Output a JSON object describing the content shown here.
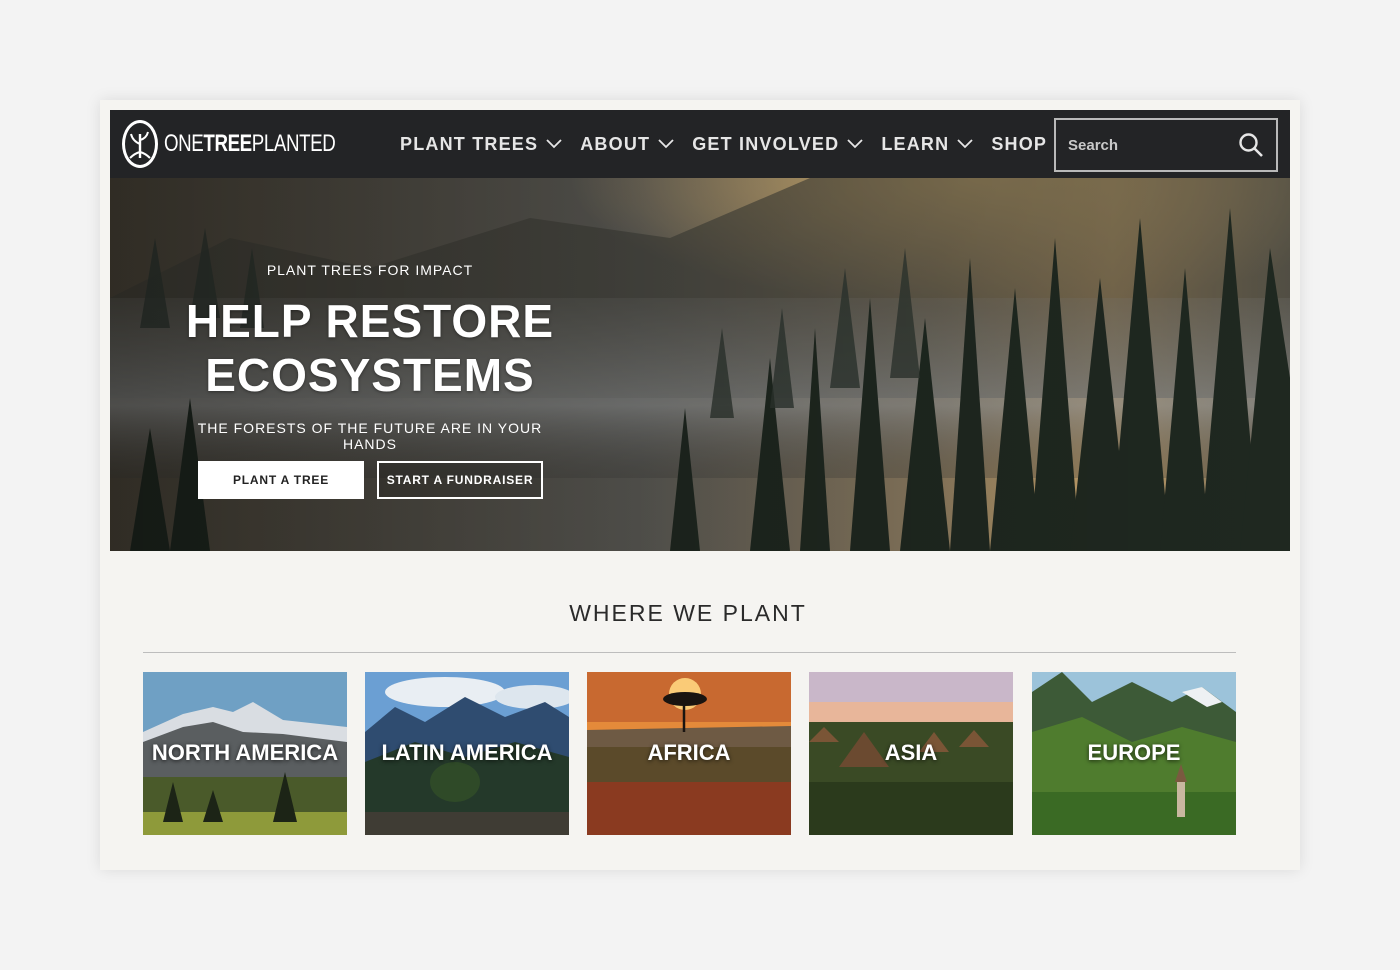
{
  "brand": {
    "name_light": "ONE",
    "name_bold": "TREE",
    "name_end": "PLANTED"
  },
  "nav": {
    "items": [
      {
        "label": "PLANT TREES"
      },
      {
        "label": "ABOUT"
      },
      {
        "label": "GET INVOLVED"
      },
      {
        "label": "LEARN"
      },
      {
        "label": "SHOP"
      }
    ],
    "search_placeholder": "Search"
  },
  "hero": {
    "eyebrow": "PLANT TREES FOR IMPACT",
    "headline_line1": "HELP RESTORE",
    "headline_line2": "ECOSYSTEMS",
    "subline": "THE FORESTS OF THE FUTURE ARE IN YOUR HANDS",
    "primary_button": "PLANT A TREE",
    "secondary_button": "START A FUNDRAISER"
  },
  "regions": {
    "title": "WHERE WE PLANT",
    "items": [
      {
        "label": "NORTH AMERICA"
      },
      {
        "label": "LATIN AMERICA"
      },
      {
        "label": "AFRICA"
      },
      {
        "label": "ASIA"
      },
      {
        "label": "EUROPE"
      }
    ]
  },
  "colors": {
    "navbar": "#232426",
    "page_bg": "#f5f4f1",
    "text_dark": "#2a2a2a"
  }
}
